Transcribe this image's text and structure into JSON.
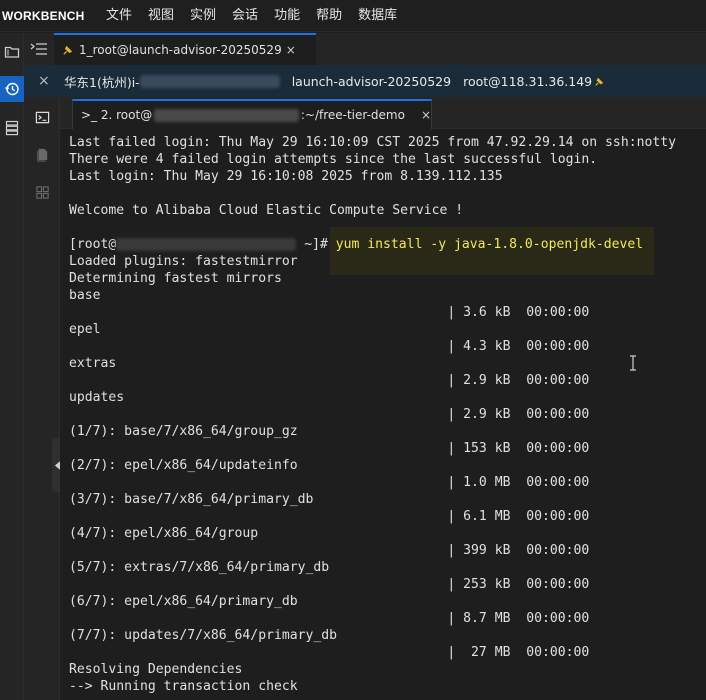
{
  "menubar": {
    "brand": "WORKBENCH",
    "items": [
      "文件",
      "视图",
      "实例",
      "会话",
      "功能",
      "帮助",
      "数据库"
    ]
  },
  "session_tab": {
    "label": "1_root@launch-advisor-20250529",
    "close": "×"
  },
  "infobar": {
    "close": "×",
    "region_prefix": "华东1(杭州)i-",
    "instance_name": "launch-advisor-20250529",
    "user_host": "root@118.31.36.149"
  },
  "terminal_tab": {
    "prefix": ">_ 2. root@",
    "suffix": ":~/free-tier-demo",
    "close": "×"
  },
  "terminal": {
    "lines": [
      "Last failed login: Thu May 29 16:10:09 CST 2025 from 47.92.29.14 on ssh:notty",
      "There were 4 failed login attempts since the last successful login.",
      "Last login: Thu May 29 16:10:08 2025 from 8.139.112.135",
      "",
      "Welcome to Alibaba Cloud Elastic Compute Service !",
      "",
      "[root@",
      "Loaded plugins: fastestmirror",
      "Determining fastest mirrors",
      "base",
      "                                                | 3.6 kB  00:00:00",
      "epel",
      "                                                | 4.3 kB  00:00:00",
      "extras",
      "                                                | 2.9 kB  00:00:00",
      "updates",
      "                                                | 2.9 kB  00:00:00",
      "(1/7): base/7/x86_64/group_gz",
      "                                                | 153 kB  00:00:00",
      "(2/7): epel/x86_64/updateinfo",
      "                                                | 1.0 MB  00:00:00",
      "(3/7): base/7/x86_64/primary_db",
      "                                                | 6.1 MB  00:00:00",
      "(4/7): epel/x86_64/group",
      "                                                | 399 kB  00:00:00",
      "(5/7): extras/7/x86_64/primary_db",
      "                                                | 253 kB  00:00:00",
      "(6/7): epel/x86_64/primary_db",
      "                                                | 8.7 MB  00:00:00",
      "(7/7): updates/7/x86_64/primary_db",
      "                                                |  27 MB  00:00:00",
      "Resolving Dependencies",
      "--> Running transaction check"
    ],
    "prompt_suffix": " ~]# ",
    "command": "yum install -y java-1.8.0-openjdk-devel"
  },
  "colors": {
    "accent": "#1a73e8",
    "active_icon_bg": "#1565c0",
    "command_text": "#f2e85c"
  }
}
